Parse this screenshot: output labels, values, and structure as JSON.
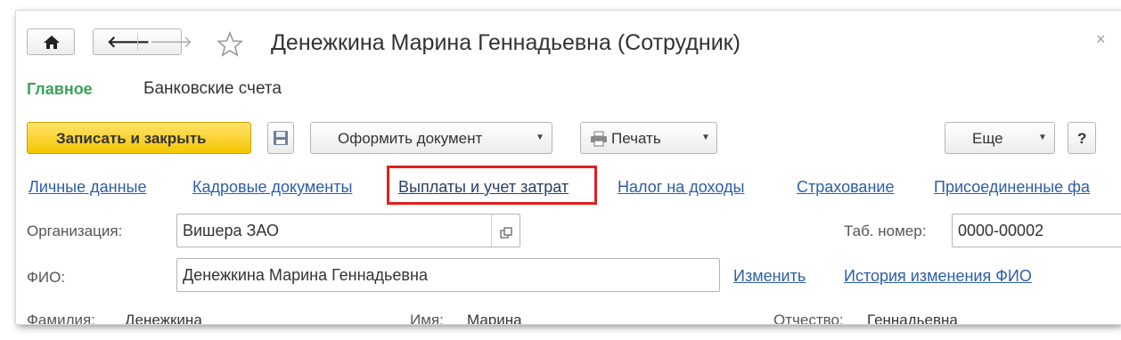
{
  "window": {
    "title": "Денежкина Марина Геннадьевна (Сотрудник)",
    "close_glyph": "×"
  },
  "icons": {
    "home": "home-icon",
    "back": "arrow-left-icon",
    "forward": "arrow-right-icon",
    "favorite": "star-icon",
    "save": "floppy-disk-icon",
    "print": "printer-icon",
    "open": "open-link-icon"
  },
  "tabs": {
    "main": "Главное",
    "bank": "Банковские счета"
  },
  "toolbar": {
    "save_close": "Записать и закрыть",
    "create_doc": "Оформить документ",
    "print": "Печать",
    "more": "Еще",
    "help": "?"
  },
  "links": {
    "personal": "Личные данные",
    "hr_docs": "Кадровые документы",
    "payments": "Выплаты и учет затрат",
    "income_tax": "Налог на доходы",
    "insurance": "Страхование",
    "attached": "Присоединенные фа"
  },
  "form": {
    "org_label": "Организация:",
    "org_value": "Вишера ЗАО",
    "tab_label": "Таб. номер:",
    "tab_value": "0000-00002",
    "fio_label": "ФИО:",
    "fio_value": "Денежкина Марина Геннадьевна",
    "change_link": "Изменить",
    "history_link": "История изменения ФИО",
    "last_name_label": "Фамилия:",
    "last_name_value": "Денежкина",
    "first_name_label": "Имя:",
    "first_name_value": "Марина",
    "patronymic_label": "Отчество:",
    "patronymic_value": "Геннадьевна"
  },
  "colors": {
    "accent_green": "#3aa25b",
    "link_blue": "#2c5ea8",
    "primary_yellow": "#f5c500",
    "highlight_red": "#e02020"
  }
}
